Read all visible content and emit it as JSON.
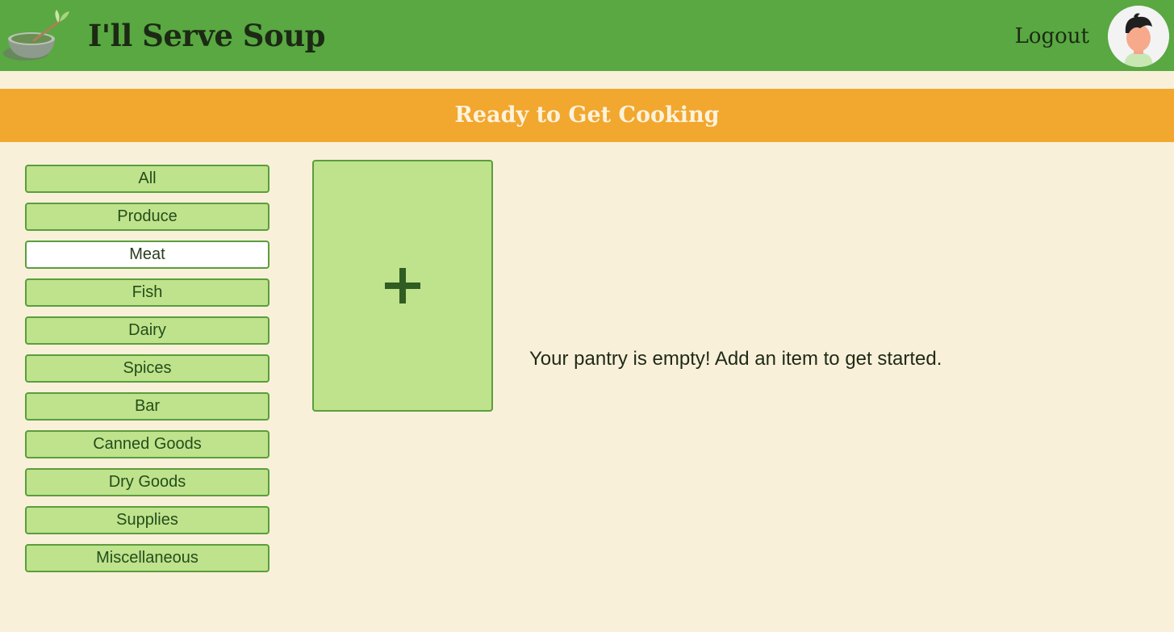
{
  "header": {
    "app_title": "I'll Serve Soup",
    "logout_label": "Logout",
    "logo_icon": "soup-bowl-icon",
    "avatar_icon": "user-avatar-icon",
    "background_color": "#59a842"
  },
  "banner": {
    "title": "Ready to Get Cooking",
    "background_color": "#f2a72f"
  },
  "sidebar": {
    "selected": "Meat",
    "categories": [
      {
        "label": "All"
      },
      {
        "label": "Produce"
      },
      {
        "label": "Meat"
      },
      {
        "label": "Fish"
      },
      {
        "label": "Dairy"
      },
      {
        "label": "Spices"
      },
      {
        "label": "Bar"
      },
      {
        "label": "Canned Goods"
      },
      {
        "label": "Dry Goods"
      },
      {
        "label": "Supplies"
      },
      {
        "label": "Miscellaneous"
      }
    ]
  },
  "main": {
    "add_item_icon": "plus-icon",
    "empty_message": "Your pantry is empty! Add an item to get started."
  },
  "colors": {
    "page_background": "#f9f0da",
    "button_fill": "#bfe28c",
    "button_border": "#5a9e3c",
    "button_text": "#244e1a"
  }
}
